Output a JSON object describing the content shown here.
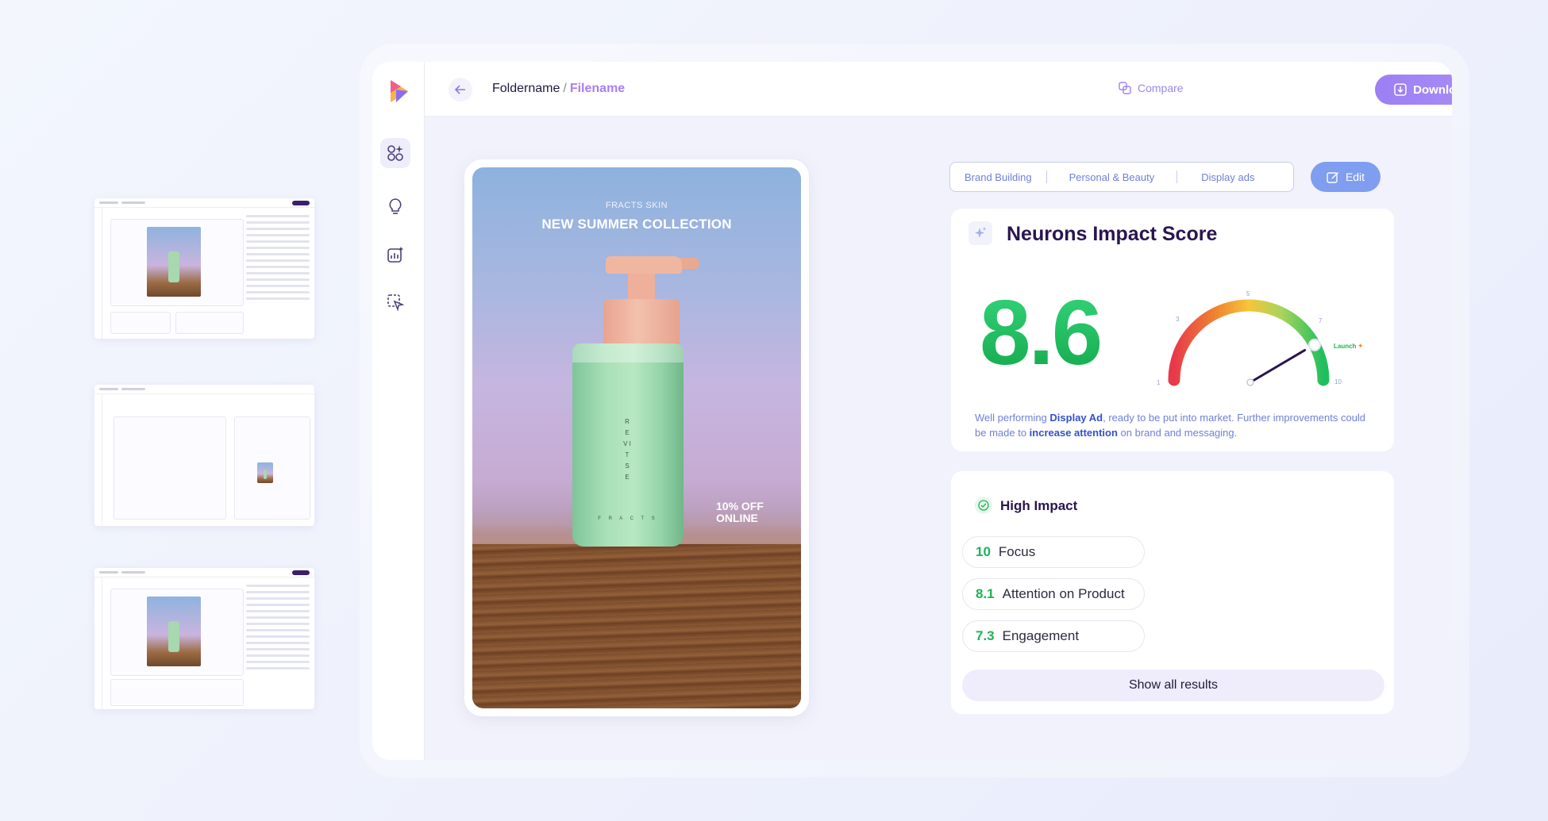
{
  "header": {
    "folder": "Foldername",
    "separator": "/",
    "file": "Filename",
    "compare_label": "Compare",
    "download_label": "Download"
  },
  "sidebar": {
    "items": [
      {
        "icon": "apps-sparkle-icon",
        "active": true
      },
      {
        "icon": "lightbulb-icon",
        "active": false
      },
      {
        "icon": "analytics-icon",
        "active": false
      },
      {
        "icon": "select-cursor-icon",
        "active": false
      }
    ]
  },
  "ad": {
    "brand": "FRACTS SKIN",
    "headline": "NEW SUMMER COLLECTION",
    "offer_line1": "10% OFF",
    "offer_line2": "ONLINE",
    "bottle_vertical": "R E V I T S E",
    "bottle_bottom": "F R A C T S"
  },
  "tags": [
    "Brand Building",
    "Personal & Beauty",
    "Display ads"
  ],
  "edit_label": "Edit",
  "score": {
    "title": "Neurons Impact Score",
    "value": "8.6",
    "gauge_value": 8.6,
    "gauge_ticks": [
      "1",
      "3",
      "5",
      "7",
      "10"
    ],
    "launch_label": "Launch",
    "desc_1": "Well performing ",
    "desc_bold_1": "Display Ad",
    "desc_2": ", ready to be put into market. Further improvements could be made to ",
    "desc_bold_2": "increase attention",
    "desc_3": " on brand and messaging."
  },
  "impact": {
    "title": "High Impact",
    "metrics": [
      {
        "value": "10",
        "label": "Focus"
      },
      {
        "value": "8.1",
        "label": "Attention on Product"
      },
      {
        "value": "7.3",
        "label": "Engagement"
      }
    ],
    "show_all_label": "Show all results"
  },
  "colors": {
    "accent": "#a87ef5",
    "score_green": "#1fbf5e",
    "link_blue": "#6f80d9",
    "title_purple": "#2a1550"
  }
}
